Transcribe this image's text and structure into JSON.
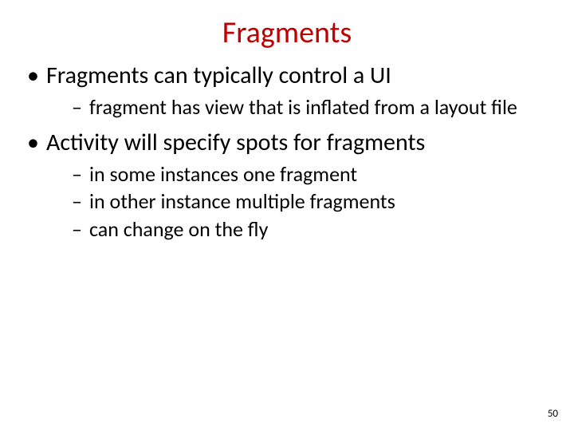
{
  "title": "Fragments",
  "bullets": [
    {
      "text": "Fragments can typically control a UI",
      "sub": [
        "fragment has view that is inflated from a layout file"
      ]
    },
    {
      "text": "Activity will specify spots for fragments",
      "sub": [
        "in some instances one fragment",
        "in other instance multiple fragments",
        "can change on the fly"
      ]
    }
  ],
  "page_number": "50"
}
